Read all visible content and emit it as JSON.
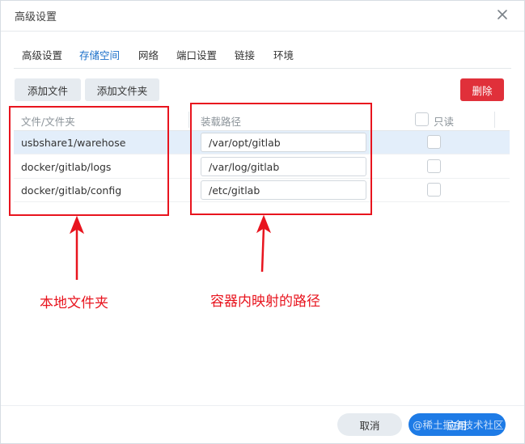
{
  "dialog": {
    "title": "高级设置"
  },
  "tabs": [
    {
      "label": "高级设置",
      "active": false
    },
    {
      "label": "存储空间",
      "active": true
    },
    {
      "label": "网络",
      "active": false
    },
    {
      "label": "端口设置",
      "active": false
    },
    {
      "label": "链接",
      "active": false
    },
    {
      "label": "环境",
      "active": false
    }
  ],
  "toolbar": {
    "add_file_label": "添加文件",
    "add_folder_label": "添加文件夹",
    "delete_label": "删除"
  },
  "table": {
    "columns": {
      "folder": "文件/文件夹",
      "mount_path": "装载路径",
      "readonly": "只读"
    },
    "rows": [
      {
        "folder": "usbshare1/warehose",
        "mount_path": "/var/opt/gitlab",
        "readonly": false,
        "selected": true
      },
      {
        "folder": "docker/gitlab/logs",
        "mount_path": "/var/log/gitlab",
        "readonly": false,
        "selected": false
      },
      {
        "folder": "docker/gitlab/config",
        "mount_path": "/etc/gitlab",
        "readonly": false,
        "selected": false
      }
    ]
  },
  "annotations": {
    "local_folder": "本地文件夹",
    "container_path": "容器内映射的路径",
    "color": "#e8141e"
  },
  "footer": {
    "cancel_label": "取消",
    "apply_label": "应用",
    "watermark": "@稀土掘金技术社区"
  },
  "colors": {
    "accent": "#1e7be6",
    "danger": "#e0303a",
    "active_tab": "#1a6fc9"
  },
  "icons": {
    "close": "close-icon"
  }
}
